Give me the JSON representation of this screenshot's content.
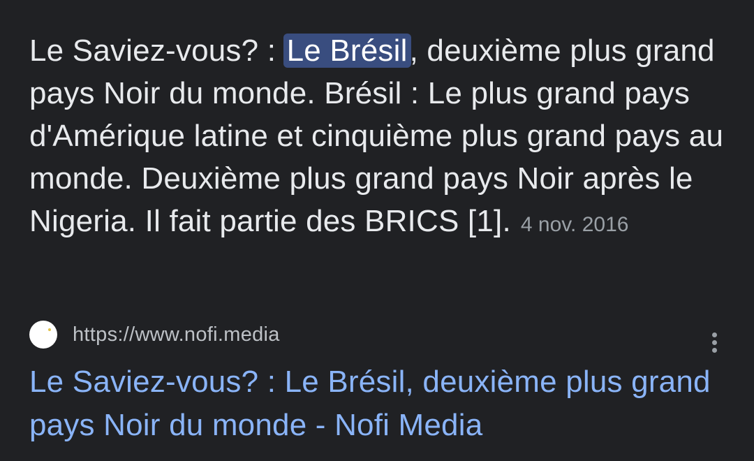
{
  "snippet": {
    "prefix": "Le Saviez-vous? : ",
    "highlight": "Le Brésil",
    "body": ", deuxième plus grand pays Noir du monde. Brésil : Le plus grand pays d'Amérique latine et cinquième plus grand pays au monde. Deuxième plus grand pays Noir après le Nigeria. Il fait partie des BRICS [1].",
    "date": "4 nov. 2016"
  },
  "source": {
    "url": "https://www.nofi.media",
    "favicon": "nofi-favicon-icon"
  },
  "result": {
    "title": "Le Saviez-vous? : Le Brésil, deuxième plus grand pays Noir du monde - Nofi Media",
    "more_icon": "more-vert-icon"
  },
  "colors": {
    "background": "#202124",
    "text": "#e8eaed",
    "highlight_bg": "#394d7f",
    "link": "#8ab4f8",
    "muted": "#9aa0a6"
  }
}
